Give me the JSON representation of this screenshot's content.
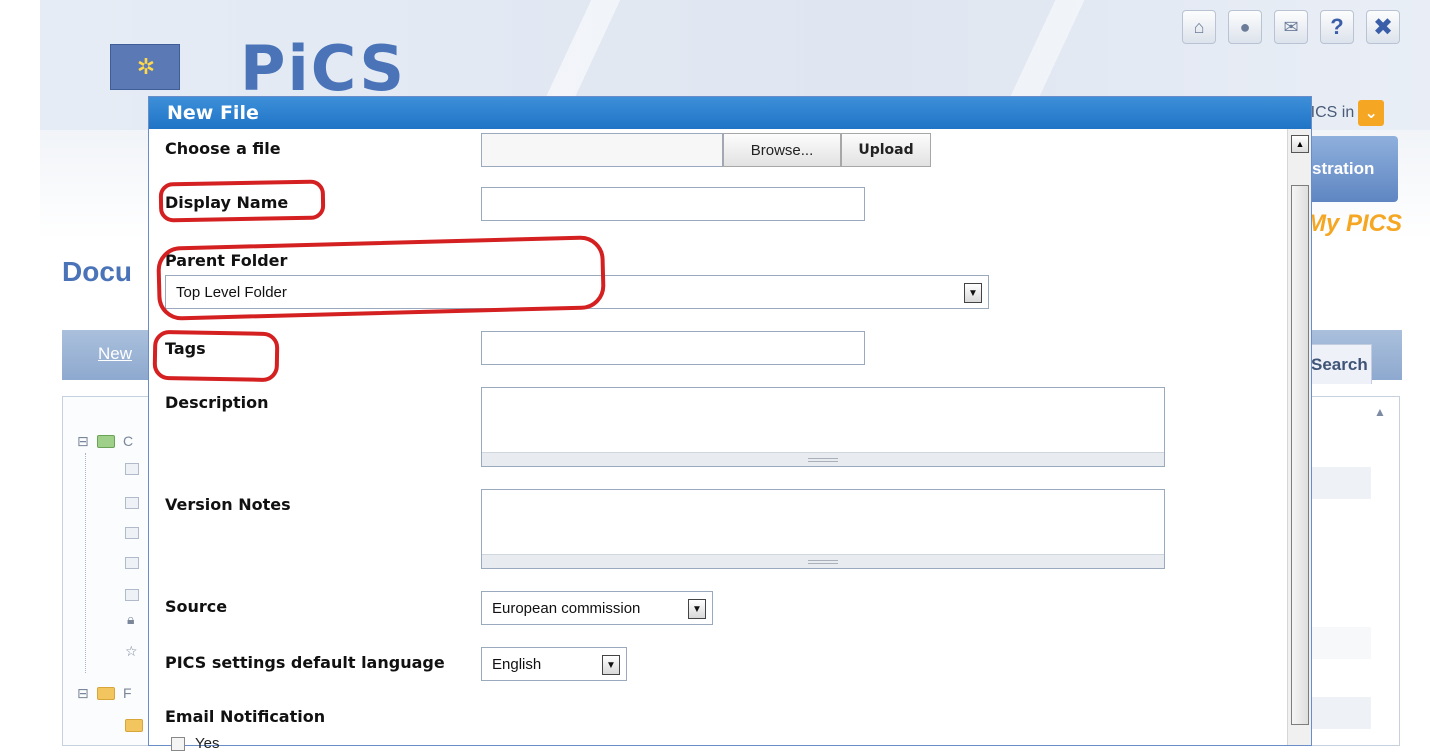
{
  "background": {
    "logo_text": "PiCS",
    "pics_in_label": "PICS in",
    "admin_button_label": "stration",
    "my_pics_label": "My PICS",
    "section_title_partial": "Docu",
    "new_link_partial": "New",
    "search_tab_partial": "Search",
    "tree_node_text_1": "C",
    "tree_node_text_2": "F"
  },
  "top_icons": [
    {
      "name": "home-icon",
      "glyph": "⌂"
    },
    {
      "name": "chat-icon",
      "glyph": "●"
    },
    {
      "name": "mail-icon",
      "glyph": "✉"
    },
    {
      "name": "help-icon",
      "glyph": "?"
    },
    {
      "name": "close-icon",
      "glyph": "✖"
    }
  ],
  "dialog": {
    "title": "New File",
    "choose_file_label": "Choose a file",
    "browse_label": "Browse...",
    "upload_label": "Upload",
    "display_name_label": "Display Name",
    "display_name_value": "",
    "parent_folder_label": "Parent Folder",
    "parent_folder_value": "Top Level Folder",
    "tags_label": "Tags",
    "tags_value": "",
    "description_label": "Description",
    "version_notes_label": "Version Notes",
    "source_label": "Source",
    "source_value": "European commission",
    "language_label": "PICS settings default language",
    "language_value": "English",
    "email_notification_label": "Email Notification",
    "email_yes_label": "Yes"
  },
  "colors": {
    "dialog_header": "#1f74c6",
    "annotation": "#d42020",
    "brand_blue": "#4a73b8",
    "accent_orange": "#f5a623"
  }
}
